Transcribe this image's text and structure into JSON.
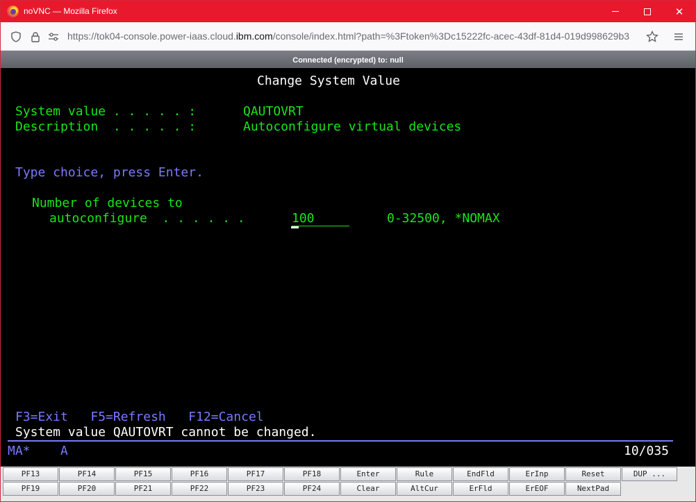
{
  "browser": {
    "window_title": "noVNC — Mozilla Firefox",
    "url_prefix": "https://tok04-console.power-iaas.cloud.",
    "url_domain": "ibm.com",
    "url_suffix": "/console/index.html?path=%3Ftoken%3Dc15222fc-acec-43df-81d4-019d998629b3"
  },
  "vnc": {
    "status": "Connected (encrypted) to: null"
  },
  "screen": {
    "title": "Change System Value",
    "sysval_label": "System value . . . . . :",
    "sysval_value": "QAUTOVRT",
    "desc_label": "Description  . . . . . :",
    "desc_value": "Autoconfigure virtual devices",
    "instruction": "Type choice, press Enter.",
    "field_label_1": "Number of devices to",
    "field_label_2": "autoconfigure  . . . . . .",
    "field_value": "100",
    "field_range": "0-32500, *NOMAX",
    "fkeys": "F3=Exit   F5=Refresh   F12=Cancel",
    "message": "System value QAUTOVRT cannot be changed.",
    "status_left": "MA*    A",
    "status_right": "10/035"
  },
  "keypad": {
    "row1": [
      "PF13",
      "PF14",
      "PF15",
      "PF16",
      "PF17",
      "PF18",
      "Enter",
      "Rule",
      "EndFld",
      "ErInp",
      "Reset",
      "DUP ..."
    ],
    "row2": [
      "PF19",
      "PF20",
      "PF21",
      "PF22",
      "PF23",
      "PF24",
      "Clear",
      "AltCur",
      "ErFld",
      "ErEOF",
      "NextPad"
    ]
  }
}
